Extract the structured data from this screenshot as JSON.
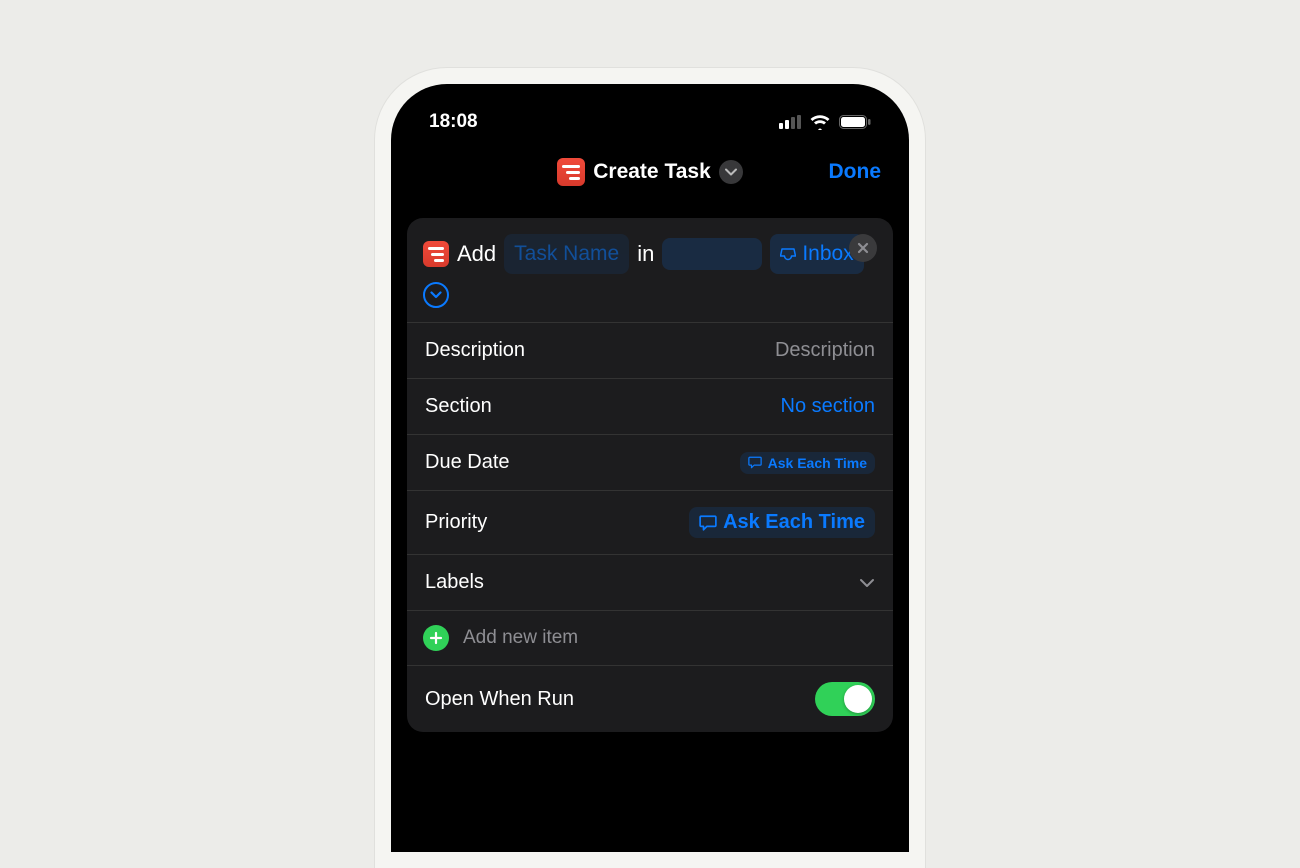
{
  "status": {
    "time": "18:08"
  },
  "nav": {
    "title": "Create Task",
    "done": "Done"
  },
  "task": {
    "verb": "Add",
    "name_placeholder": "Task Name",
    "preposition": "in",
    "project": "Inbox"
  },
  "fields": {
    "description": {
      "label": "Description",
      "placeholder": "Description"
    },
    "section": {
      "label": "Section",
      "value": "No section"
    },
    "due_date": {
      "label": "Due Date",
      "value": "Ask Each Time"
    },
    "priority": {
      "label": "Priority",
      "value": "Ask Each Time"
    },
    "labels": {
      "label": "Labels"
    },
    "add_item": "Add new item",
    "open_when_run": {
      "label": "Open When Run",
      "on": true
    }
  }
}
